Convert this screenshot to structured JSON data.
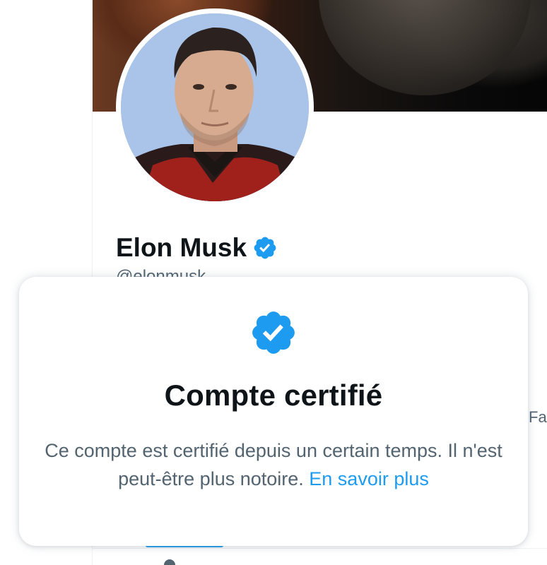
{
  "colors": {
    "accent": "#1d9bf0",
    "text_primary": "#0f1419",
    "text_secondary": "#536471",
    "border": "#eff3f4"
  },
  "profile": {
    "display_name": "Elon Musk",
    "handle": "@elonmusk",
    "verified_icon": "verified-badge-icon"
  },
  "side_text": "Fa",
  "popover": {
    "icon": "verified-badge-icon",
    "title": "Compte certifié",
    "body": "Ce compte est certifié depuis un certain temps. Il n'est peut-être plus notoire.",
    "learn_more": "En savoir plus"
  }
}
